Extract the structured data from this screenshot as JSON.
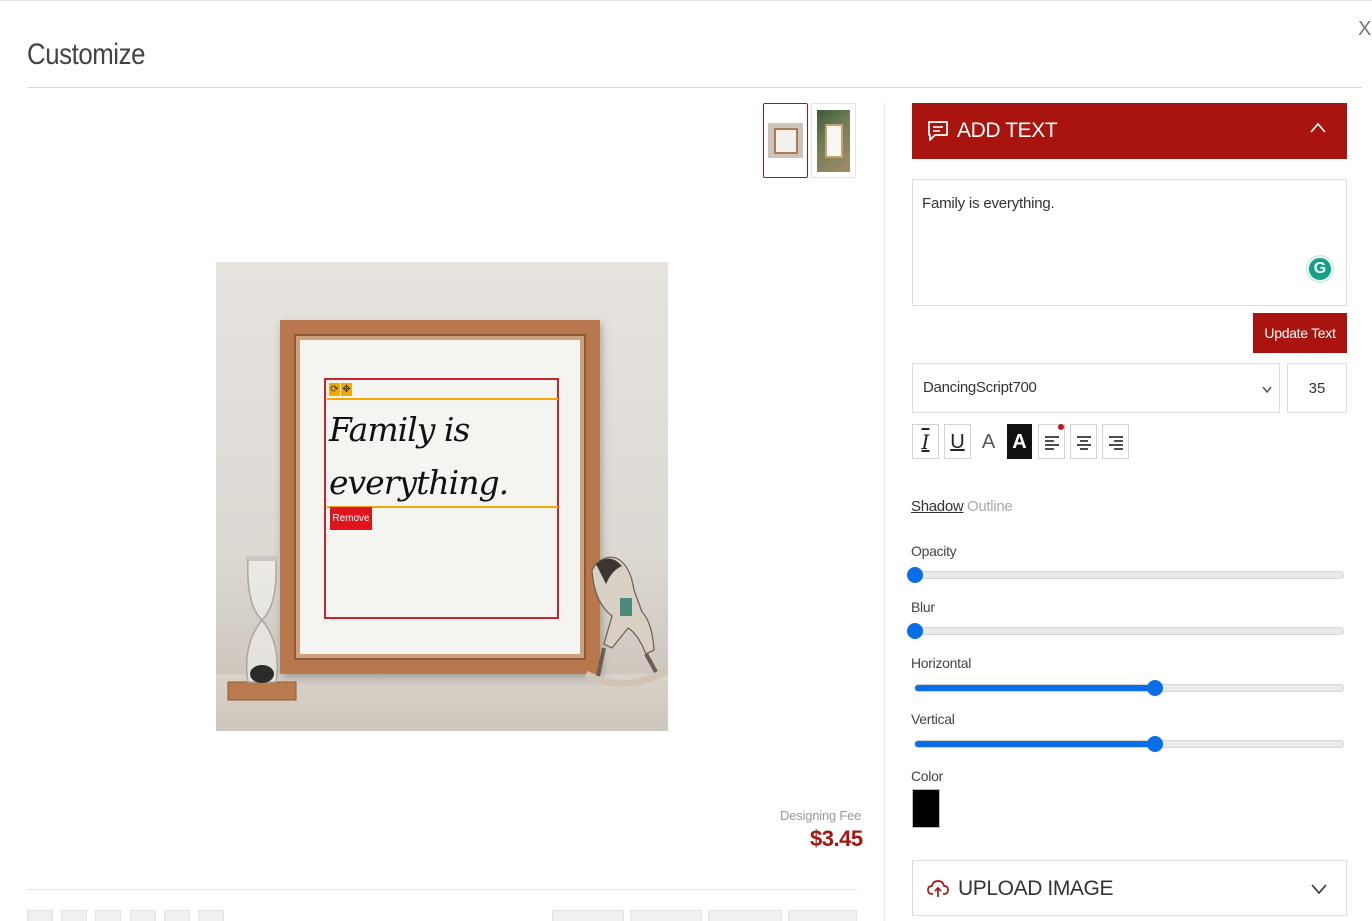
{
  "dialog": {
    "title": "Customize",
    "close_label": "X"
  },
  "preview": {
    "thumbnails": [
      "frame-on-table",
      "frame-with-plants"
    ],
    "canvas_text_line1": "Family is",
    "canvas_text_line2": "everything.",
    "remove_label": "Remove",
    "fee_label": "Designing Fee",
    "fee_value": "$3.45"
  },
  "add_text_panel": {
    "title": "ADD TEXT",
    "text_value": "Family is everything.",
    "update_label": "Update Text",
    "font_family": "DancingScript700",
    "font_size": "35",
    "format_buttons": [
      "italic",
      "underline",
      "text-outline",
      "text-fill",
      "align-left",
      "align-center",
      "align-right"
    ],
    "tabs": {
      "shadow": "Shadow",
      "outline": "Outline",
      "active": "Shadow"
    },
    "sliders": {
      "opacity": {
        "label": "Opacity",
        "value": 0.0
      },
      "blur": {
        "label": "Blur",
        "value": 0.0
      },
      "horizontal": {
        "label": "Horizontal",
        "value": 0.56
      },
      "vertical": {
        "label": "Vertical",
        "value": 0.56
      }
    },
    "color_label": "Color",
    "color_value": "#000000"
  },
  "upload_panel": {
    "title": "UPLOAD IMAGE"
  },
  "theme": {
    "accent": "#a9140e",
    "slider": "#0a6ee8",
    "remove": "#e0141c",
    "handles": "#f2a800"
  }
}
